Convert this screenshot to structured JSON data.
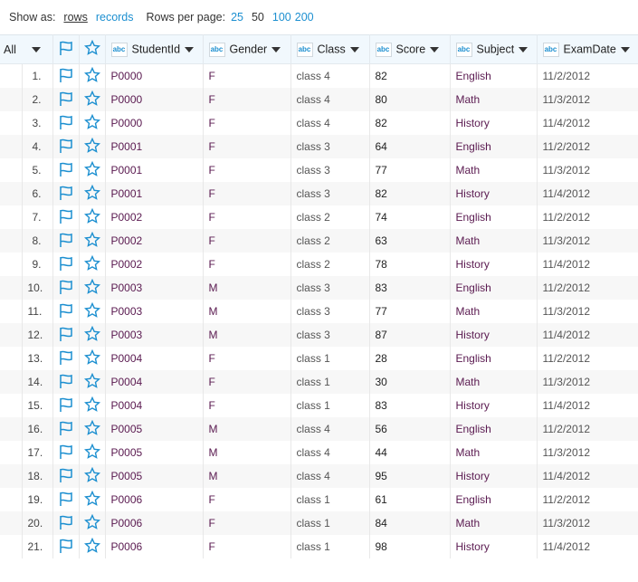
{
  "toolbar": {
    "show_as": "Show as:",
    "rows": "rows",
    "records": "records",
    "rows_per_page": "Rows per page:",
    "sizes": [
      "25",
      "50",
      "100",
      "200"
    ]
  },
  "header": {
    "all": "All",
    "columns": [
      "StudentId",
      "Gender",
      "Class",
      "Score",
      "Subject",
      "ExamDate"
    ],
    "type_badge": "abc"
  },
  "rows": [
    [
      "1.",
      "P0000",
      "F",
      "class 4",
      "82",
      "English",
      "11/2/2012"
    ],
    [
      "2.",
      "P0000",
      "F",
      "class 4",
      "80",
      "Math",
      "11/3/2012"
    ],
    [
      "3.",
      "P0000",
      "F",
      "class 4",
      "82",
      "History",
      "11/4/2012"
    ],
    [
      "4.",
      "P0001",
      "F",
      "class 3",
      "64",
      "English",
      "11/2/2012"
    ],
    [
      "5.",
      "P0001",
      "F",
      "class 3",
      "77",
      "Math",
      "11/3/2012"
    ],
    [
      "6.",
      "P0001",
      "F",
      "class 3",
      "82",
      "History",
      "11/4/2012"
    ],
    [
      "7.",
      "P0002",
      "F",
      "class 2",
      "74",
      "English",
      "11/2/2012"
    ],
    [
      "8.",
      "P0002",
      "F",
      "class 2",
      "63",
      "Math",
      "11/3/2012"
    ],
    [
      "9.",
      "P0002",
      "F",
      "class 2",
      "78",
      "History",
      "11/4/2012"
    ],
    [
      "10.",
      "P0003",
      "M",
      "class 3",
      "83",
      "English",
      "11/2/2012"
    ],
    [
      "11.",
      "P0003",
      "M",
      "class 3",
      "77",
      "Math",
      "11/3/2012"
    ],
    [
      "12.",
      "P0003",
      "M",
      "class 3",
      "87",
      "History",
      "11/4/2012"
    ],
    [
      "13.",
      "P0004",
      "F",
      "class 1",
      "28",
      "English",
      "11/2/2012"
    ],
    [
      "14.",
      "P0004",
      "F",
      "class 1",
      "30",
      "Math",
      "11/3/2012"
    ],
    [
      "15.",
      "P0004",
      "F",
      "class 1",
      "83",
      "History",
      "11/4/2012"
    ],
    [
      "16.",
      "P0005",
      "M",
      "class 4",
      "56",
      "English",
      "11/2/2012"
    ],
    [
      "17.",
      "P0005",
      "M",
      "class 4",
      "44",
      "Math",
      "11/3/2012"
    ],
    [
      "18.",
      "P0005",
      "M",
      "class 4",
      "95",
      "History",
      "11/4/2012"
    ],
    [
      "19.",
      "P0006",
      "F",
      "class 1",
      "61",
      "English",
      "11/2/2012"
    ],
    [
      "20.",
      "P0006",
      "F",
      "class 1",
      "84",
      "Math",
      "11/3/2012"
    ],
    [
      "21.",
      "P0006",
      "F",
      "class 1",
      "98",
      "History",
      "11/4/2012"
    ]
  ]
}
